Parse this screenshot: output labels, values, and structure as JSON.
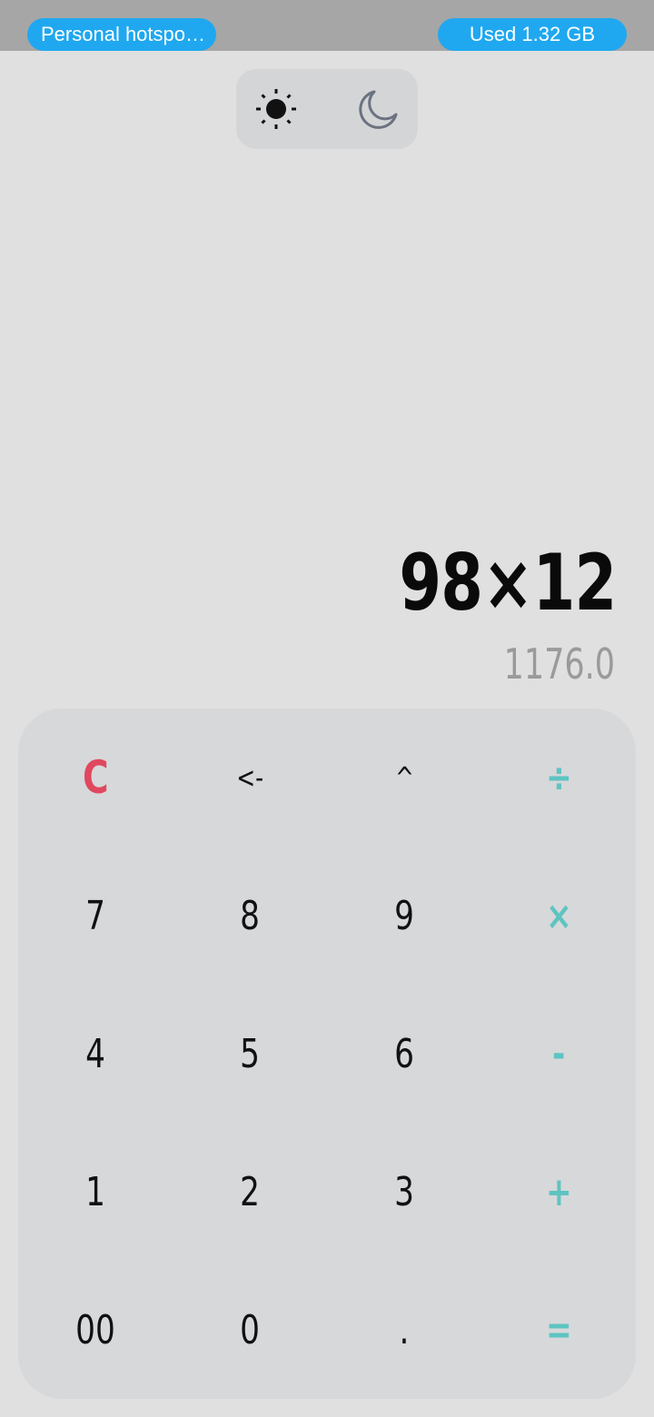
{
  "status_bar": {
    "hotspot_label": "Personal hotspo…",
    "data_usage_label": "Used  1.32 GB"
  },
  "theme_toggle": {
    "light_icon": "sun-icon",
    "dark_icon": "moon-icon",
    "selected": "light"
  },
  "display": {
    "expression": "98×12",
    "result": "1176.0"
  },
  "keypad": {
    "row1": [
      "C",
      "<-",
      "^",
      "÷"
    ],
    "row2": [
      "7",
      "8",
      "9",
      "×"
    ],
    "row3": [
      "4",
      "5",
      "6",
      "-"
    ],
    "row4": [
      "1",
      "2",
      "3",
      "+"
    ],
    "row5": [
      "00",
      "0",
      ".",
      "="
    ]
  },
  "colors": {
    "accent_operator": "#5ec4c2",
    "clear_key": "#e0485f",
    "status_pill": "#1fa8f0"
  }
}
